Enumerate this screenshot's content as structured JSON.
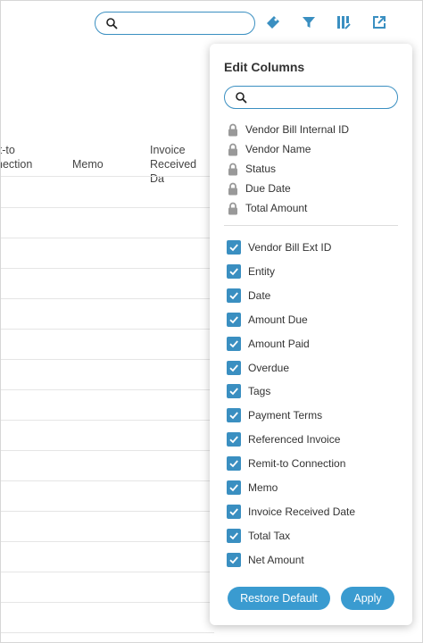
{
  "toolbar": {
    "search_placeholder": "",
    "icons": [
      "search-icon",
      "tag-icon",
      "filter-icon",
      "columns-icon",
      "export-icon"
    ]
  },
  "table": {
    "headers": [
      {
        "label": "it-to nection"
      },
      {
        "label": "Memo"
      },
      {
        "label": "Invoice Received Da"
      }
    ]
  },
  "panel": {
    "title": "Edit Columns",
    "search_placeholder": "",
    "locked_columns": [
      "Vendor Bill Internal ID",
      "Vendor Name",
      "Status",
      "Due Date",
      "Total Amount"
    ],
    "columns": [
      {
        "label": "Vendor Bill Ext ID",
        "checked": true
      },
      {
        "label": "Entity",
        "checked": true
      },
      {
        "label": "Date",
        "checked": true
      },
      {
        "label": "Amount Due",
        "checked": true
      },
      {
        "label": "Amount Paid",
        "checked": true
      },
      {
        "label": "Overdue",
        "checked": true
      },
      {
        "label": "Tags",
        "checked": true
      },
      {
        "label": "Payment Terms",
        "checked": true
      },
      {
        "label": "Referenced Invoice",
        "checked": true
      },
      {
        "label": "Remit-to Connection",
        "checked": true
      },
      {
        "label": "Memo",
        "checked": true
      },
      {
        "label": "Invoice Received Date",
        "checked": true
      },
      {
        "label": "Total Tax",
        "checked": true
      },
      {
        "label": "Net Amount",
        "checked": true
      }
    ],
    "restore_label": "Restore Default",
    "apply_label": "Apply"
  },
  "colors": {
    "accent": "#3a8fc1",
    "button": "#3a9bd0",
    "lock": "#999999"
  }
}
